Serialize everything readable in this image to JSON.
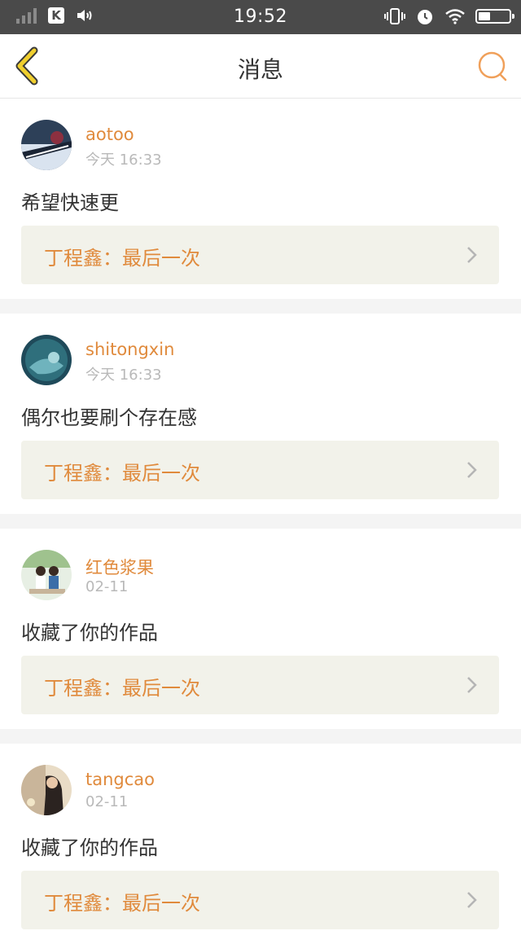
{
  "status_bar": {
    "time": "19:52",
    "k_label": "K"
  },
  "header": {
    "title": "消息"
  },
  "colors": {
    "accent": "#e08a3c",
    "back_arrow": "#e0b82a",
    "reply_bg": "#f2f2ea"
  },
  "messages": [
    {
      "username": "aotoo",
      "time": "今天 16:33",
      "content": "希望快速更",
      "reply": "丁程鑫：最后一次"
    },
    {
      "username": "shitongxin",
      "time": "今天 16:33",
      "content": "偶尔也要刷个存在感",
      "reply": "丁程鑫：最后一次"
    },
    {
      "username": "红色浆果",
      "time": "02-11",
      "content": "收藏了你的作品",
      "reply": "丁程鑫：最后一次"
    },
    {
      "username": "tangcao",
      "time": "02-11",
      "content": "收藏了你的作品",
      "reply": "丁程鑫：最后一次"
    }
  ]
}
